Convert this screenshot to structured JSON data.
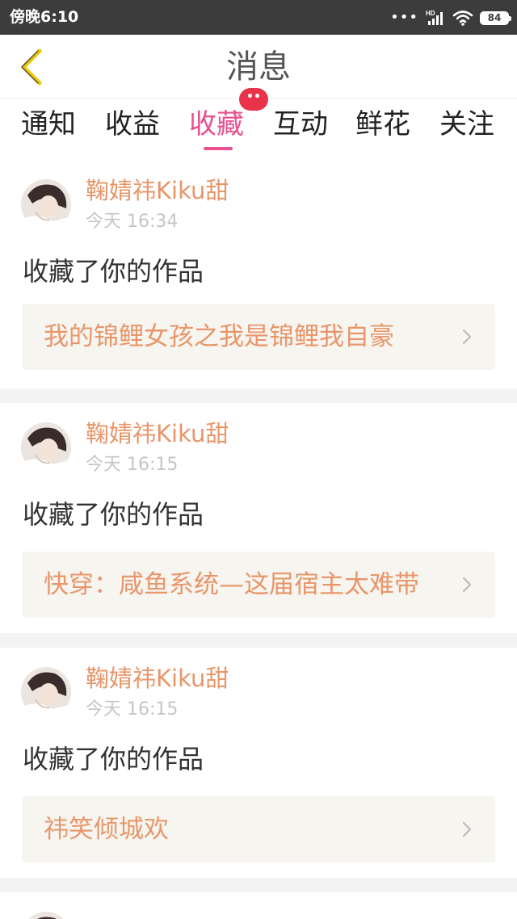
{
  "status_bar": {
    "time": "傍晚6:10",
    "network_badge": "HD",
    "battery": "84"
  },
  "header": {
    "title": "消息"
  },
  "tabs": [
    {
      "label": "通知"
    },
    {
      "label": "收益"
    },
    {
      "label": "收藏",
      "active": true
    },
    {
      "label": "互动"
    },
    {
      "label": "鲜花"
    },
    {
      "label": "关注"
    }
  ],
  "notifications": [
    {
      "user": "鞠婧祎Kiku甜",
      "time": "今天 16:34",
      "action": "收藏了你的作品",
      "work_title": "我的锦鲤女孩之我是锦鲤我自豪"
    },
    {
      "user": "鞠婧祎Kiku甜",
      "time": "今天 16:15",
      "action": "收藏了你的作品",
      "work_title": "快穿：咸鱼系统—这届宿主太难带"
    },
    {
      "user": "鞠婧祎Kiku甜",
      "time": "今天 16:15",
      "action": "收藏了你的作品",
      "work_title": "祎笑倾城欢"
    }
  ],
  "colors": {
    "accent": "#e8508f",
    "link": "#e8966a",
    "badge": "#e8334a",
    "statusbar": "#3c3c3c"
  }
}
